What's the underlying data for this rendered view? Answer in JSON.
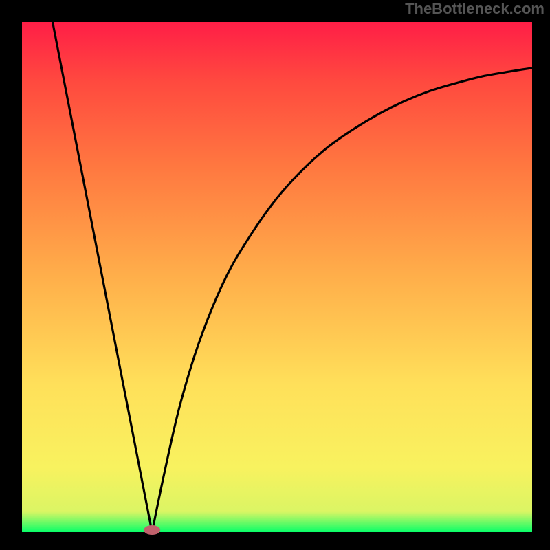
{
  "watermark": "TheBottleneck.com",
  "chart_data": {
    "type": "line",
    "title": "",
    "xlabel": "",
    "ylabel": "",
    "xlim": [
      0,
      1
    ],
    "ylim": [
      0,
      1
    ],
    "left_line": {
      "x": [
        0.06,
        0.255
      ],
      "y": [
        1.0,
        0.0
      ]
    },
    "right_curve": {
      "x": [
        0.255,
        0.28,
        0.31,
        0.35,
        0.4,
        0.45,
        0.5,
        0.55,
        0.6,
        0.65,
        0.7,
        0.75,
        0.8,
        0.85,
        0.9,
        0.95,
        1.0
      ],
      "y": [
        0.0,
        0.12,
        0.25,
        0.38,
        0.5,
        0.585,
        0.655,
        0.71,
        0.755,
        0.79,
        0.82,
        0.845,
        0.865,
        0.88,
        0.893,
        0.902,
        0.91
      ]
    },
    "marker": {
      "x": 0.255,
      "y": 0.0,
      "color": "#c0616c"
    },
    "gradient_stops": [
      {
        "offset": 0.0,
        "color": "#000000"
      },
      {
        "offset": 0.03,
        "color": "#000000"
      },
      {
        "offset": 0.031,
        "color": "#00ff68"
      },
      {
        "offset": 0.07,
        "color": "#dbf564"
      },
      {
        "offset": 0.15,
        "color": "#f8f25f"
      },
      {
        "offset": 0.3,
        "color": "#ffe05a"
      },
      {
        "offset": 0.5,
        "color": "#ffae4a"
      },
      {
        "offset": 0.7,
        "color": "#ff7740"
      },
      {
        "offset": 0.85,
        "color": "#ff4a3f"
      },
      {
        "offset": 0.97,
        "color": "#ff1a47"
      },
      {
        "offset": 1.0,
        "color": "#ff1a47"
      }
    ]
  }
}
